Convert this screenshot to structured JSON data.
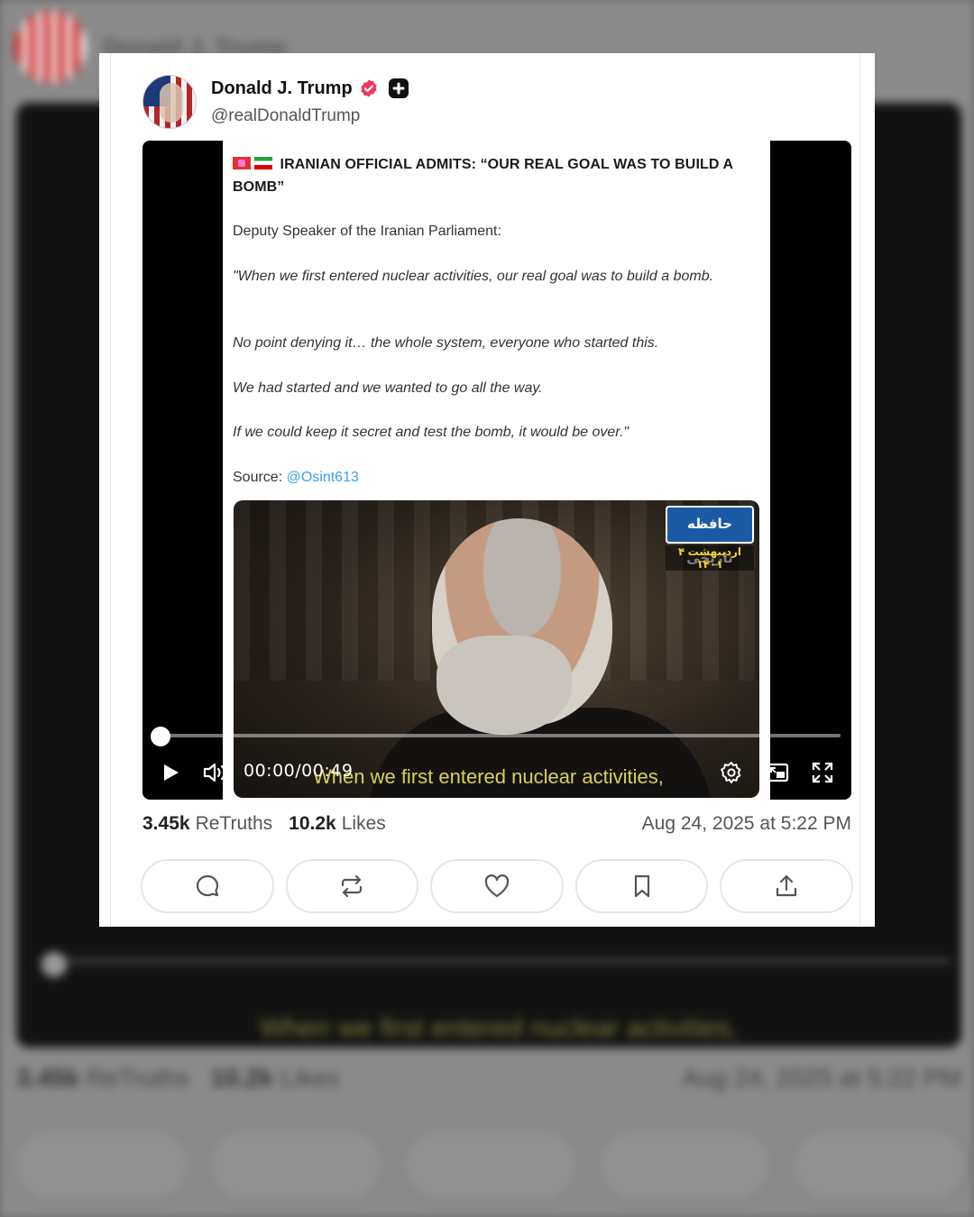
{
  "author": {
    "name": "Donald J. Trump",
    "handle": "@realDonaldTrump"
  },
  "post_screenshot": {
    "title": "IRANIAN OFFICIAL ADMITS: “OUR REAL GOAL WAS TO BUILD A BOMB”",
    "intro": "Deputy Speaker of the Iranian Parliament:",
    "quote_1": "\"When we first entered nuclear activities, our real goal was to build a bomb.",
    "quote_2": "No point denying it… the whole system, everyone who started this.",
    "quote_3": "We had started and we wanted to go all the way.",
    "quote_4": "If we could keep it secret and test the bomb, it would be over.\"",
    "source_label": "Source:",
    "source_handle": "@Osint613",
    "clip_logo_text": "حافظه تاریخی",
    "clip_date": "۴ اردیبهشت ۱۴۰۱",
    "clip_subtitle": "When we first entered nuclear activities,"
  },
  "video": {
    "current_time": "00:00",
    "separator": "/",
    "duration": "00:49",
    "progress_fraction": 0.0
  },
  "stats": {
    "retruths_count": "3.45k",
    "retruths_label": "ReTruths",
    "likes_count": "10.2k",
    "likes_label": "Likes",
    "timestamp": "Aug 24, 2025 at 5:22 PM"
  },
  "colors": {
    "verified": "#f0365b",
    "link": "#3aa0e8",
    "subtitle": "#d8d15a"
  },
  "icons": {
    "actions": [
      "reply-icon",
      "retruth-icon",
      "like-icon",
      "bookmark-icon",
      "share-icon"
    ],
    "player": [
      "play-icon",
      "volume-icon",
      "settings-icon",
      "pip-icon",
      "fullscreen-icon"
    ]
  }
}
